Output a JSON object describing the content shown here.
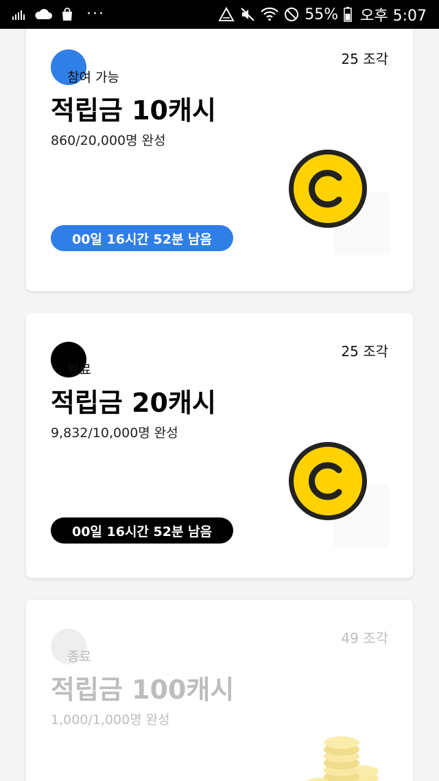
{
  "status_bar": {
    "dots": "···",
    "battery_percent": "55%",
    "time": "오후 5:07"
  },
  "colors": {
    "status_available": "#2f7fe6",
    "status_done": "#000000",
    "status_ended": "#eeeeee",
    "coin_yellow": "#ffd200",
    "coin_outline": "#222222"
  },
  "cards": [
    {
      "status": "참여 가능",
      "pieces": "25 조각",
      "title": "적립금 10캐시",
      "progress": "860/20,000명 완성",
      "timer": "00일 16시간 52분 남음",
      "icon": "cash-coin-icon"
    },
    {
      "status": "완료",
      "pieces": "25 조각",
      "title": "적립금 20캐시",
      "progress": "9,832/10,000명 완성",
      "timer": "00일 16시간 52분 남음",
      "icon": "cash-coin-icon"
    },
    {
      "status": "종료",
      "pieces": "49 조각",
      "title": "적립금 100캐시",
      "progress": "1,000/1,000명 완성",
      "icon": "gold-coins-stack-icon"
    }
  ]
}
